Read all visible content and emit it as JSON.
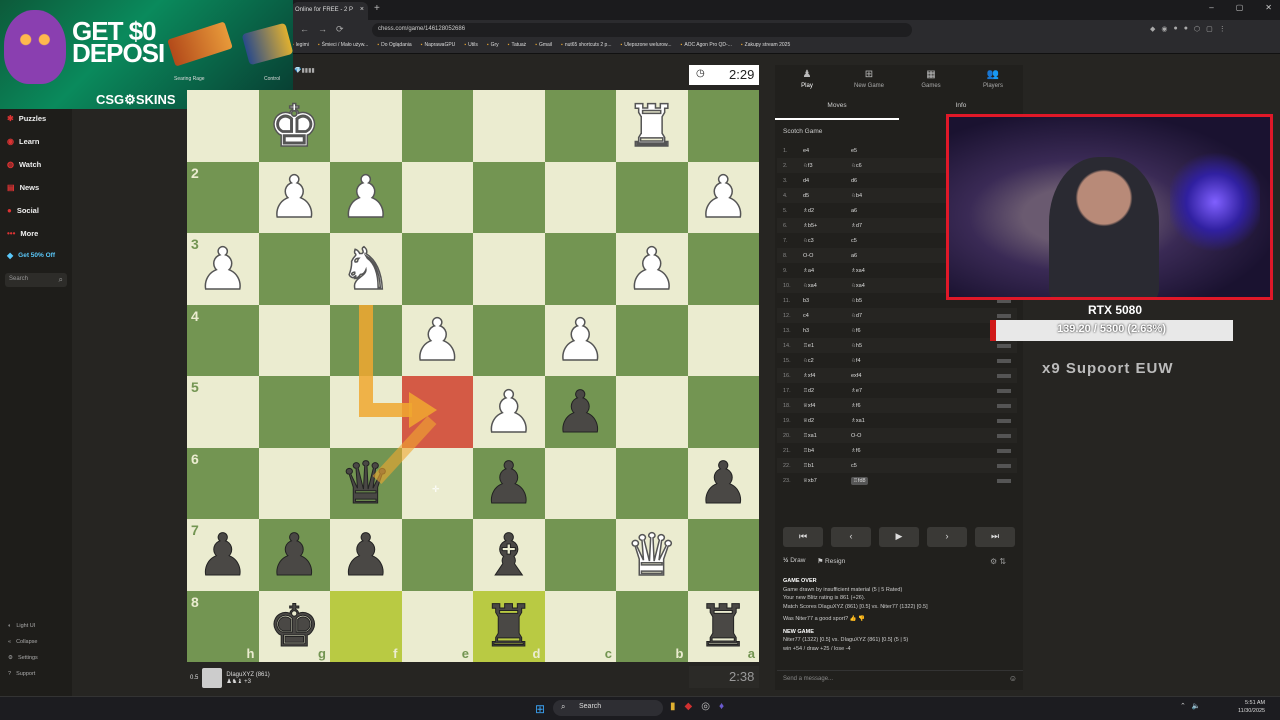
{
  "browser": {
    "tab_title": "Online for FREE - 2 P",
    "tab_close": "×",
    "new_tab": "+",
    "url": "chess.com/game/146128052686",
    "window_controls": [
      "–",
      "▢",
      "✕"
    ],
    "nav_icons": [
      "←",
      "→",
      "⟳"
    ],
    "bookmarks": [
      "legimi",
      "Śmieci / Mało używ...",
      "Do Oglądania",
      "NaprawaGPU",
      "Utils",
      "Gry",
      "Tatuaż",
      "Gmail",
      "nut65 shortcuts 2 p...",
      "Ulepszone welurow...",
      "AOC Agon Pro QD-...",
      "Zakupy stream 2025"
    ]
  },
  "ad": {
    "headline": "GET $0\nDEPOSI",
    "brand": "CSG⚙SKINS",
    "caption1": "Searing Rage",
    "caption2": "Control"
  },
  "sidebar": {
    "items": [
      {
        "label": "Puzzles",
        "icon": "puzzle-icon",
        "glyph": "✱"
      },
      {
        "label": "Learn",
        "icon": "learn-icon",
        "glyph": "◉"
      },
      {
        "label": "Watch",
        "icon": "watch-icon",
        "glyph": "◍"
      },
      {
        "label": "News",
        "icon": "news-icon",
        "glyph": "▤"
      },
      {
        "label": "Social",
        "icon": "social-icon",
        "glyph": "●"
      },
      {
        "label": "More",
        "icon": "more-icon",
        "glyph": "•••"
      },
      {
        "label": "Get 50% Off",
        "icon": "diamond-icon",
        "glyph": "◆"
      }
    ],
    "search_placeholder": "Search",
    "footer": [
      {
        "label": "Light UI",
        "glyph": "◐"
      },
      {
        "label": "Collapse",
        "glyph": "«"
      },
      {
        "label": "Settings",
        "glyph": "⚙"
      },
      {
        "label": "Support",
        "glyph": "?"
      }
    ]
  },
  "board": {
    "orientation": "black",
    "rank_labels": [
      "",
      "2",
      "3",
      "4",
      "5",
      "6",
      "7",
      "8"
    ],
    "file_labels": [
      "h",
      "g",
      "f",
      "e",
      "d",
      "c",
      "b",
      "a"
    ],
    "rows": [
      [
        "",
        "wK",
        "",
        "",
        "",
        "",
        "wR",
        ""
      ],
      [
        "",
        "wP",
        "wP",
        "",
        "",
        "",
        "",
        "wP"
      ],
      [
        "wP",
        "",
        "wN",
        "",
        "",
        "",
        "wP",
        ""
      ],
      [
        "",
        "",
        "",
        "wP",
        "",
        "wP",
        "",
        ""
      ],
      [
        "",
        "",
        "",
        "",
        "wP",
        "bP",
        "",
        ""
      ],
      [
        "",
        "",
        "bQ",
        "",
        "bP",
        "",
        "",
        "bP"
      ],
      [
        "bP",
        "bP",
        "bP",
        "",
        "bB",
        "",
        "wQ",
        ""
      ],
      [
        "",
        "bK",
        "",
        "",
        "bR",
        "",
        "",
        "bR"
      ]
    ],
    "highlight_red": [
      [
        4,
        3
      ]
    ],
    "highlight_yellow": [
      [
        7,
        2
      ],
      [
        7,
        4
      ]
    ],
    "arrow_color": "#f0a830"
  },
  "clocks": {
    "top": "2:29",
    "bottom": "2:38",
    "timer_icon": "◷"
  },
  "player_bottom": {
    "score": "0.5",
    "name": "DIaguXYZ (861)",
    "material": "♟♞♝ +3"
  },
  "top_player_icons": "💎▮▮▮▮",
  "panel": {
    "tabs": [
      {
        "label": "Play",
        "glyph": "♟",
        "icon": "play-icon"
      },
      {
        "label": "New Game",
        "glyph": "⊞",
        "icon": "new-game-icon"
      },
      {
        "label": "Games",
        "glyph": "▦",
        "icon": "games-icon"
      },
      {
        "label": "Players",
        "glyph": "👥",
        "icon": "players-icon"
      }
    ],
    "subtabs": [
      "Moves",
      "Info"
    ],
    "opening": "Scotch Game",
    "moves": [
      {
        "n": "1.",
        "w": "e4",
        "b": "e5"
      },
      {
        "n": "2.",
        "w": "♘f3",
        "b": "♘c6"
      },
      {
        "n": "3.",
        "w": "d4",
        "b": "d6"
      },
      {
        "n": "4.",
        "w": "d5",
        "b": "♘b4"
      },
      {
        "n": "5.",
        "w": "♗d2",
        "b": "a6"
      },
      {
        "n": "6.",
        "w": "♗b5+",
        "b": "♗d7"
      },
      {
        "n": "7.",
        "w": "♘c3",
        "b": "c5"
      },
      {
        "n": "8.",
        "w": "O-O",
        "b": "a6"
      },
      {
        "n": "9.",
        "w": "♗a4",
        "b": "♗xa4"
      },
      {
        "n": "10.",
        "w": "♘xa4",
        "b": "♘xa4"
      },
      {
        "n": "11.",
        "w": "b3",
        "b": "♘b5"
      },
      {
        "n": "12.",
        "w": "c4",
        "b": "♘d7"
      },
      {
        "n": "13.",
        "w": "h3",
        "b": "♘f6"
      },
      {
        "n": "14.",
        "w": "♖e1",
        "b": "♘h5"
      },
      {
        "n": "15.",
        "w": "♘c2",
        "b": "♘f4"
      },
      {
        "n": "16.",
        "w": "♗xf4",
        "b": "exf4"
      },
      {
        "n": "17.",
        "w": "♖d2",
        "b": "♗e7"
      },
      {
        "n": "18.",
        "w": "♕xf4",
        "b": "♗f6"
      },
      {
        "n": "19.",
        "w": "♕d2",
        "b": "♗xa1"
      },
      {
        "n": "20.",
        "w": "♖xa1",
        "b": "O-O"
      },
      {
        "n": "21.",
        "w": "♖b4",
        "b": "♗f6"
      },
      {
        "n": "22.",
        "w": "♖b1",
        "b": "c5"
      },
      {
        "n": "23.",
        "w": "♕xb7",
        "b": "♖fd8"
      }
    ],
    "controls": [
      "⏮",
      "‹",
      "▶",
      "›",
      "⏭"
    ],
    "draw_label": "Draw",
    "resign_label": "Resign",
    "draw_icon": "½",
    "resign_icon": "⚑",
    "log": {
      "game_over": "GAME OVER",
      "line1": "Game drawn by insufficient material (5 | 5 Rated)",
      "line2": "Your new Blitz rating is 861 (+26).",
      "line3": "Match Scores DIaguXYZ (861) [0.5] vs. Niter77 (1322) [0.5]",
      "sport": "Was Niter77 a good sport?",
      "new_game": "NEW GAME",
      "line4": "Niter77 (1322) [0.5] vs. DIaguXYZ (861) [0.5] (5 | 5)",
      "line5": "win +54 / draw +25 / lose -4"
    },
    "message_placeholder": "Send a message...",
    "message_icon": "☺"
  },
  "stream": {
    "gpu_title": "RTX 5080",
    "gpu_progress_text": "139.20 / 5300 (2.63%)",
    "gpu_progress_percent": 2.63,
    "gpu_color": "#d01818",
    "overlay_text": "x9 Supoort   EUW"
  },
  "taskbar": {
    "search": "Search",
    "start_glyph": "⊞",
    "time": "5:51 AM",
    "date": "11/30/2025",
    "apps": [
      "▮",
      "◆",
      "◎",
      "♦"
    ]
  }
}
